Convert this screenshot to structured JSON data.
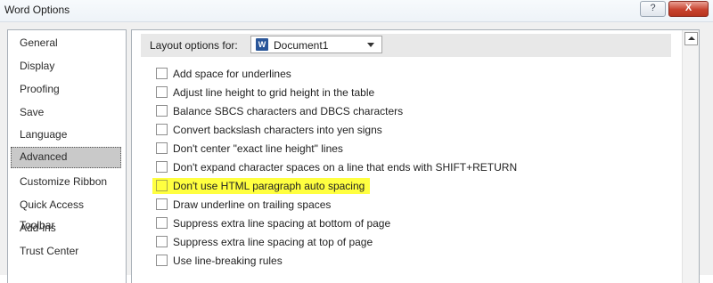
{
  "window": {
    "title": "Word Options",
    "help_label": "?",
    "close_label": "X"
  },
  "sidebar": {
    "items": [
      {
        "label": "General"
      },
      {
        "label": "Display"
      },
      {
        "label": "Proofing"
      },
      {
        "label": "Save"
      },
      {
        "label": "Language"
      },
      {
        "label": "Advanced",
        "selected": true
      },
      {
        "label": "Customize Ribbon"
      },
      {
        "label": "Quick Access Toolbar"
      },
      {
        "label": "Add-ins"
      },
      {
        "label": "Trust Center"
      }
    ]
  },
  "layout": {
    "label": "Layout options for:",
    "document": "Document1",
    "doc_icon": "word-document-icon"
  },
  "options": [
    {
      "label": "Add space for underlines",
      "checked": false
    },
    {
      "label": "Adjust line height to grid height in the table",
      "checked": false
    },
    {
      "label": "Balance SBCS characters and DBCS characters",
      "checked": false
    },
    {
      "label": "Convert backslash characters into yen signs",
      "checked": false
    },
    {
      "label": "Don't center \"exact line height\" lines",
      "checked": false
    },
    {
      "label": "Don't expand character spaces on a line that ends with SHIFT+RETURN",
      "checked": false
    },
    {
      "label": "Don't use HTML paragraph auto spacing",
      "checked": false,
      "highlighted": true
    },
    {
      "label": "Draw underline on trailing spaces",
      "checked": false
    },
    {
      "label": "Suppress extra line spacing at bottom of page",
      "checked": false
    },
    {
      "label": "Suppress extra line spacing at top of page",
      "checked": false
    },
    {
      "label": "Use line-breaking rules",
      "checked": false
    }
  ],
  "colors": {
    "highlight": "#ffff40",
    "selected_nav": "#c9c9c9",
    "close_button": "#c8432f"
  }
}
